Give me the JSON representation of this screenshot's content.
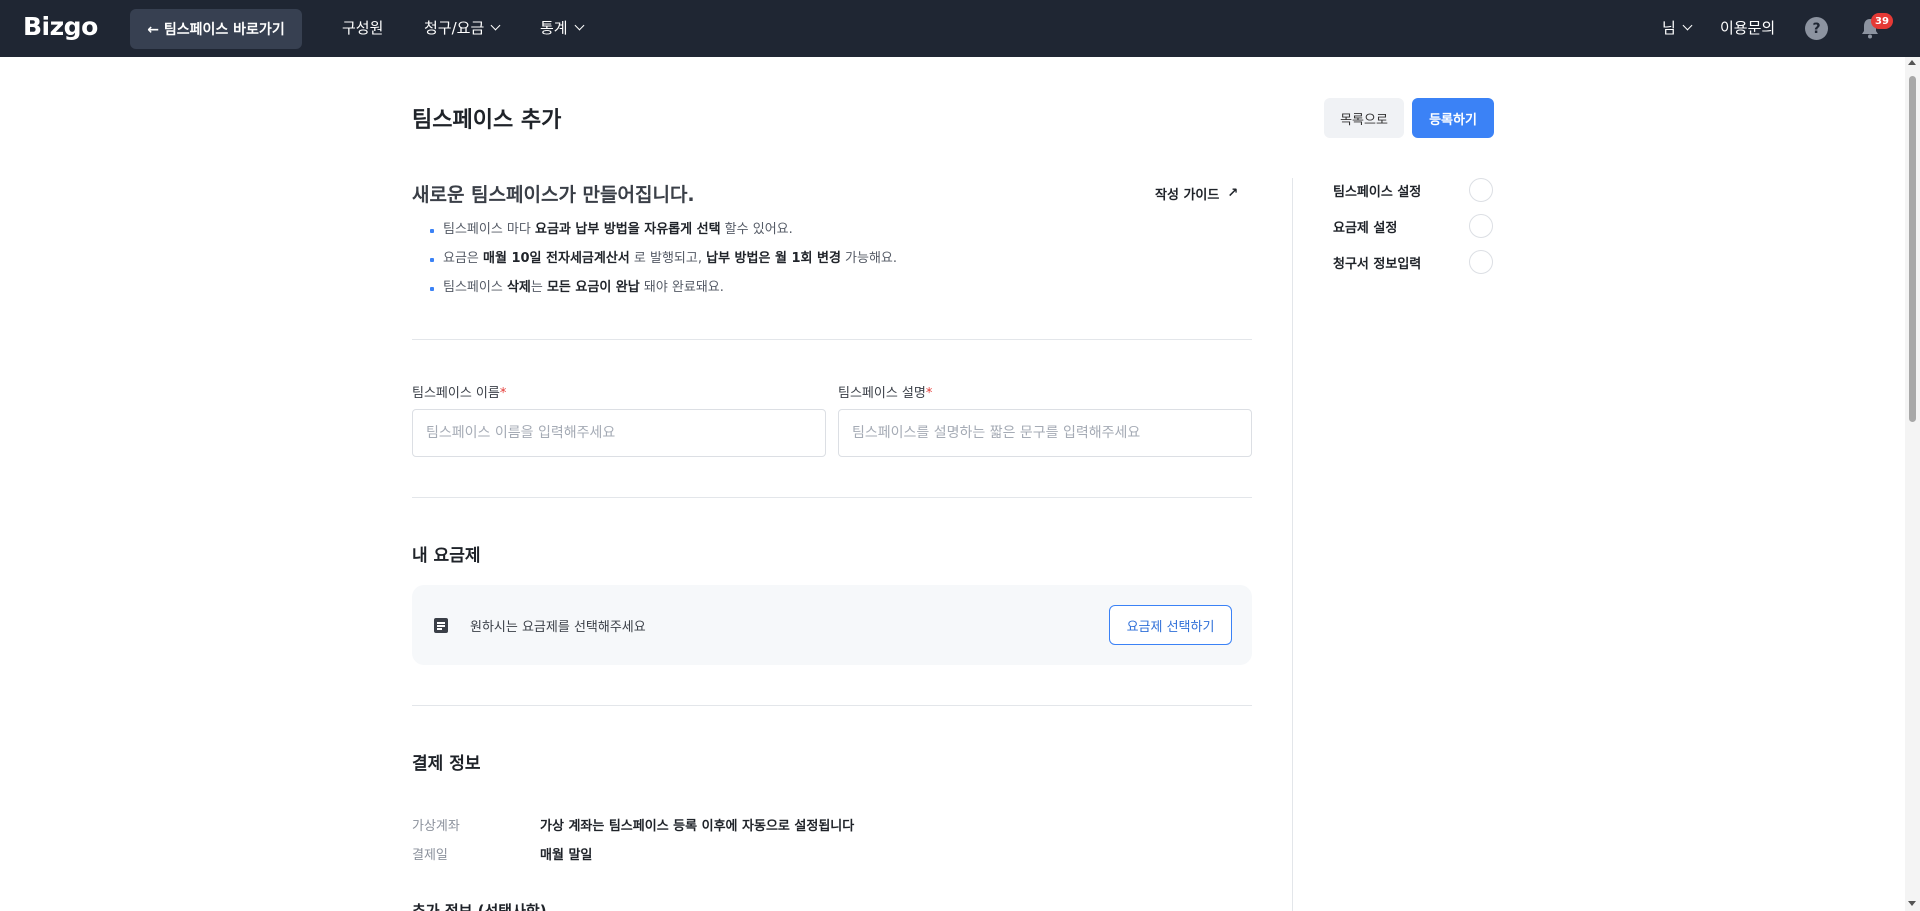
{
  "header": {
    "logo": "Bizgo",
    "back_label": "← 팀스페이스 바로가기",
    "nav": [
      "구성원",
      "청구/요금",
      "통계"
    ],
    "user_label": "님",
    "support_label": "이용문의",
    "help_symbol": "?",
    "notification_count": "39"
  },
  "page": {
    "title": "팀스페이스 추가",
    "list_button": "목록으로",
    "register_button": "등록하기"
  },
  "intro": {
    "title": "새로운 팀스페이스가 만들어집니다.",
    "guide_link": "작성 가이드",
    "guide_arrow": "↗",
    "bullets": [
      {
        "a": "팀스페이스 마다 ",
        "b": "요금과 납부 방법을 자유롭게 선택",
        "c": " 할수 있어요.",
        "d": "",
        "e": ""
      },
      {
        "a": "요금은 ",
        "b": "매월 10일 전자세금계산서",
        "c": " 로 발행되고, ",
        "d": "납부 방법은 월 1회 변경",
        "e": " 가능해요."
      },
      {
        "a": "팀스페이스 ",
        "b": "삭제",
        "c": "는 ",
        "d": "모든 요금이 완납",
        "e": " 돼야 완료돼요."
      }
    ]
  },
  "form": {
    "name_label": "팀스페이스 이름",
    "name_placeholder": "팀스페이스 이름을 입력해주세요",
    "desc_label": "팀스페이스 설명",
    "desc_placeholder": "팀스페이스를 설명하는 짧은 문구를 입력해주세요",
    "required_mark": "*"
  },
  "plan": {
    "section_title": "내 요금제",
    "prompt": "원하시는 요금제를 선택해주세요",
    "select_button": "요금제 선택하기"
  },
  "payment": {
    "section_title": "결제 정보",
    "rows": [
      {
        "key": "가상계좌",
        "value": "가상 계좌는 팀스페이스 등록 이후에 자동으로 설정됩니다"
      },
      {
        "key": "결제일",
        "value": "매월 말일"
      }
    ],
    "next_section_cut": "추가 정보 (선택사항)"
  },
  "steps": [
    {
      "label": "팀스페이스 설정"
    },
    {
      "label": "요금제 설정"
    },
    {
      "label": "청구서 정보입력"
    }
  ],
  "colors": {
    "topbar": "#1f2633",
    "accent": "#3b82f6",
    "required": "#e53935"
  }
}
